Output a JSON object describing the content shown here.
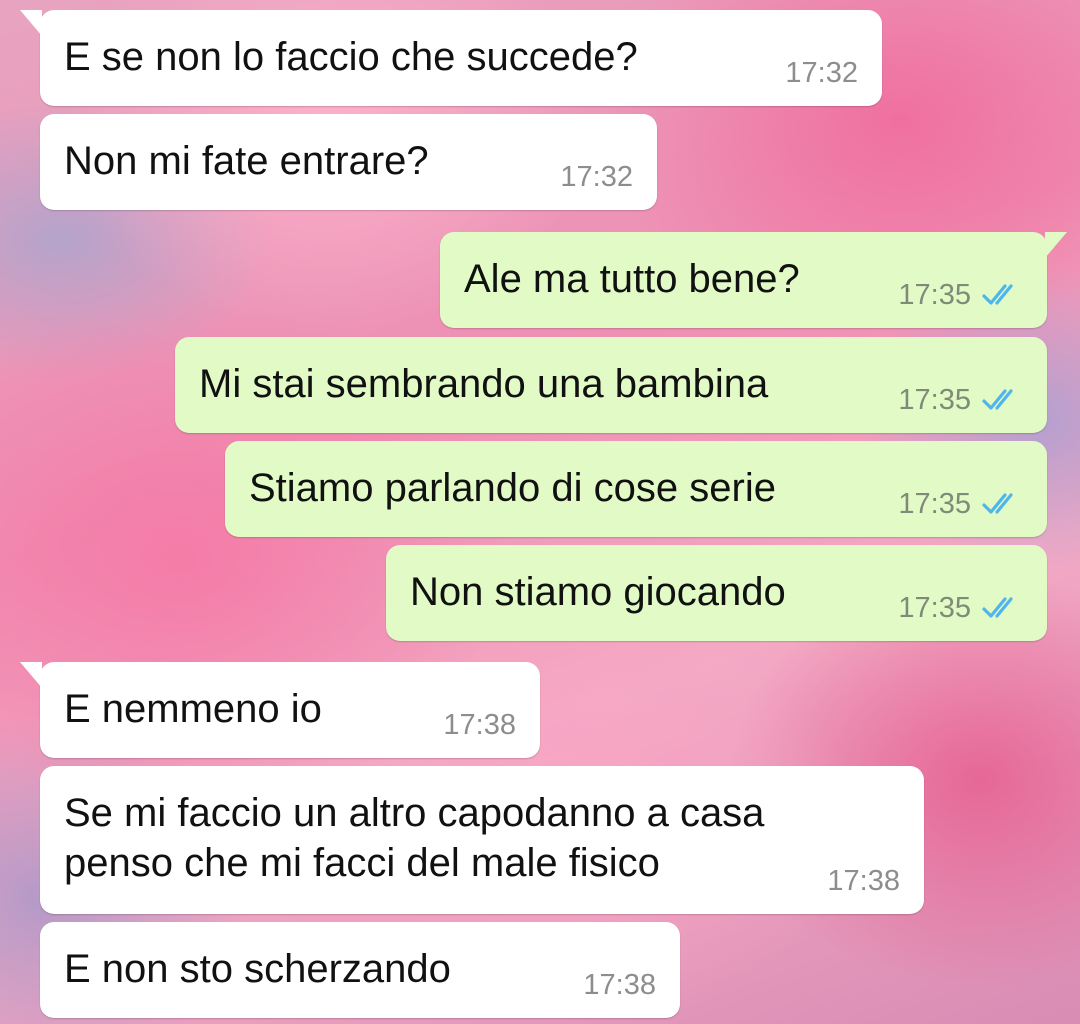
{
  "colors": {
    "incoming_bubble": "#ffffff",
    "outgoing_bubble": "#e2fbc6",
    "read_ticks": "#4fb6ec",
    "timestamp": "#8d8d8d"
  },
  "messages": [
    {
      "direction": "incoming",
      "text": "E se non lo faccio che succede?",
      "time": "17:32"
    },
    {
      "direction": "incoming",
      "text": "Non mi fate entrare?",
      "time": "17:32"
    },
    {
      "direction": "outgoing",
      "text": "Ale ma tutto bene?",
      "time": "17:35",
      "status": "read-double-check-icon"
    },
    {
      "direction": "outgoing",
      "text": "Mi stai sembrando una bambina",
      "time": "17:35",
      "status": "read-double-check-icon"
    },
    {
      "direction": "outgoing",
      "text": "Stiamo parlando di cose serie",
      "time": "17:35",
      "status": "read-double-check-icon"
    },
    {
      "direction": "outgoing",
      "text": "Non stiamo giocando",
      "time": "17:35",
      "status": "read-double-check-icon"
    },
    {
      "direction": "incoming",
      "text": "E nemmeno io",
      "time": "17:38"
    },
    {
      "direction": "incoming",
      "text": "Se mi faccio un altro capodanno a casa\npenso che mi facci del male fisico",
      "time": "17:38"
    },
    {
      "direction": "incoming",
      "text": "E non sto scherzando",
      "time": "17:38"
    }
  ]
}
